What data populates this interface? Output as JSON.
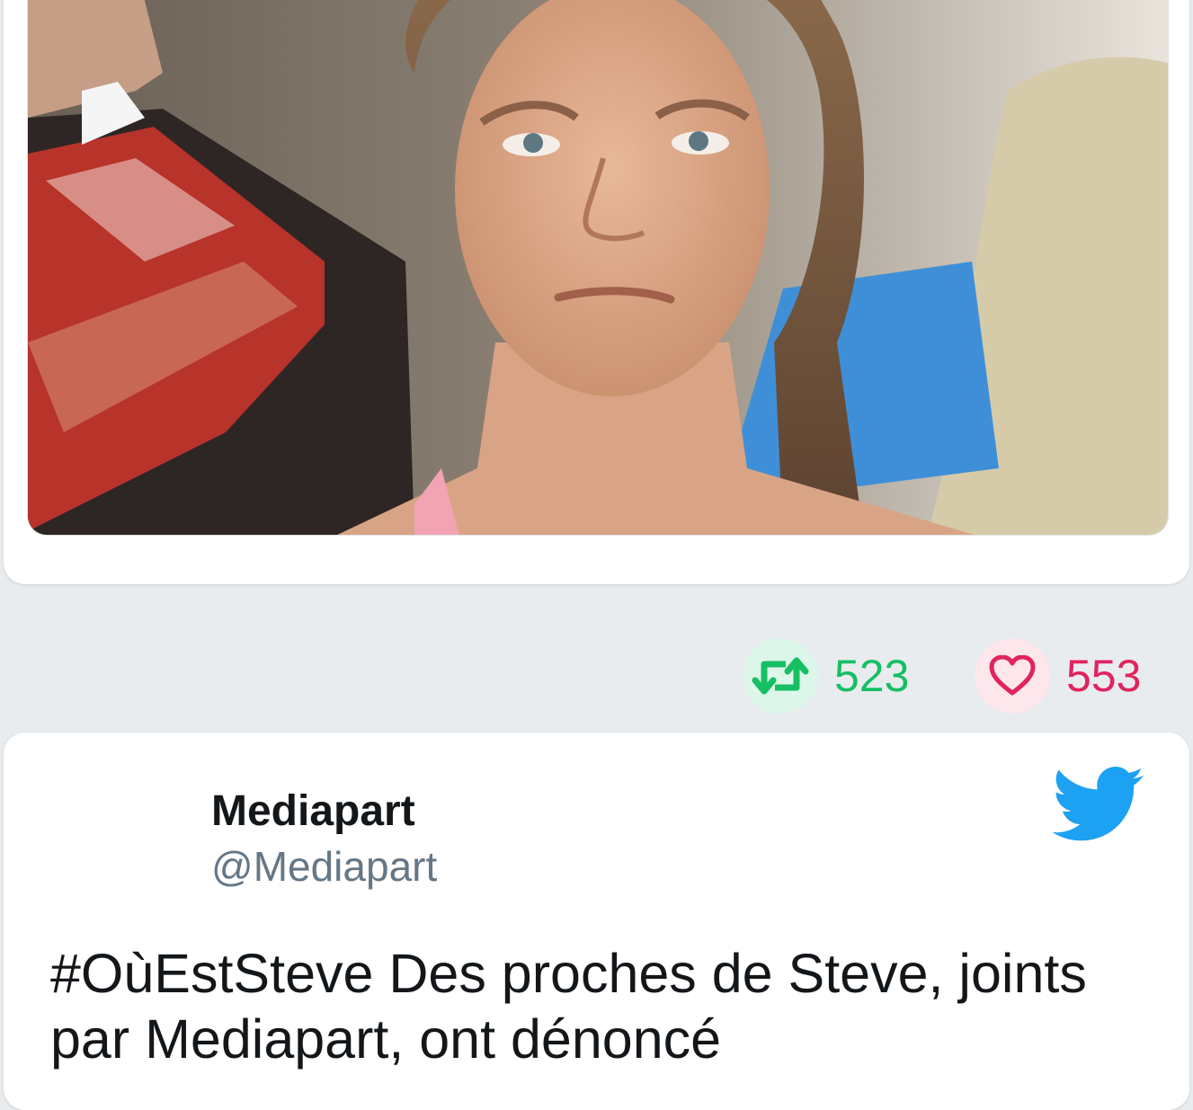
{
  "colors": {
    "retweet": "#17bf63",
    "like": "#e0245e",
    "twitter_blue": "#1da1f2",
    "handle_gray": "#657786"
  },
  "tweet_1": {
    "retweet_count": "523",
    "like_count": "553",
    "retweet_icon": "retweet-icon",
    "like_icon": "heart-icon"
  },
  "tweet_2": {
    "author_name": "Mediapart",
    "author_handle": "@Mediapart",
    "logo_icon": "twitter-bird-icon",
    "text": "#OùEstSteve Des proches de Steve, joints par Mediapart, ont dénoncé"
  }
}
